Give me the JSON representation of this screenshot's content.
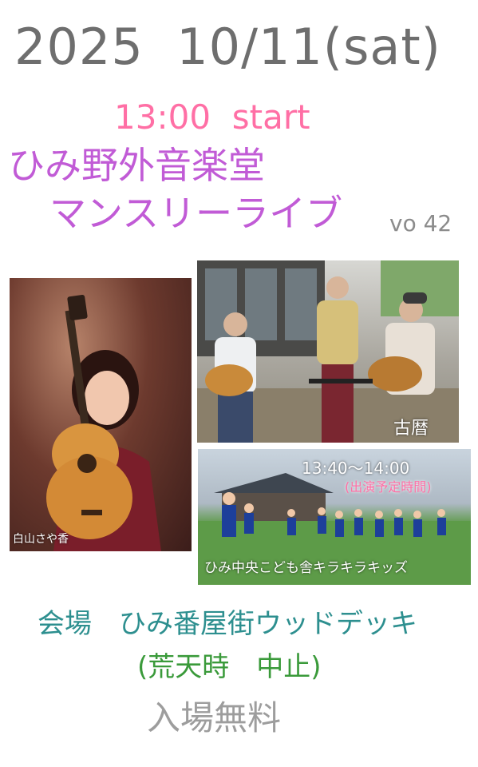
{
  "event": {
    "date": "2025  10/11(sat)",
    "start_time": "13:00  start",
    "title_line1": "ひみ野外音楽堂",
    "title_line2": "マンスリーライブ",
    "volume": "vo 42"
  },
  "performers": {
    "solo_name": "白山さや香",
    "band_name": "古暦",
    "kids_time": "13:40～14:00",
    "kids_time_note": "(出演予定時間)",
    "kids_group": "ひみ中央こども舎キラキラキッズ"
  },
  "venue": {
    "label": "会場　ひみ番屋街ウッドデッキ",
    "weather_note": "(荒天時　中止)",
    "admission": "入場無料"
  },
  "colors": {
    "date": "#6e6e6e",
    "start": "#ff6fa5",
    "title": "#c15bd6",
    "venue": "#2d8f8f",
    "weather": "#3a9a3a",
    "admission": "#9d9d9d"
  }
}
